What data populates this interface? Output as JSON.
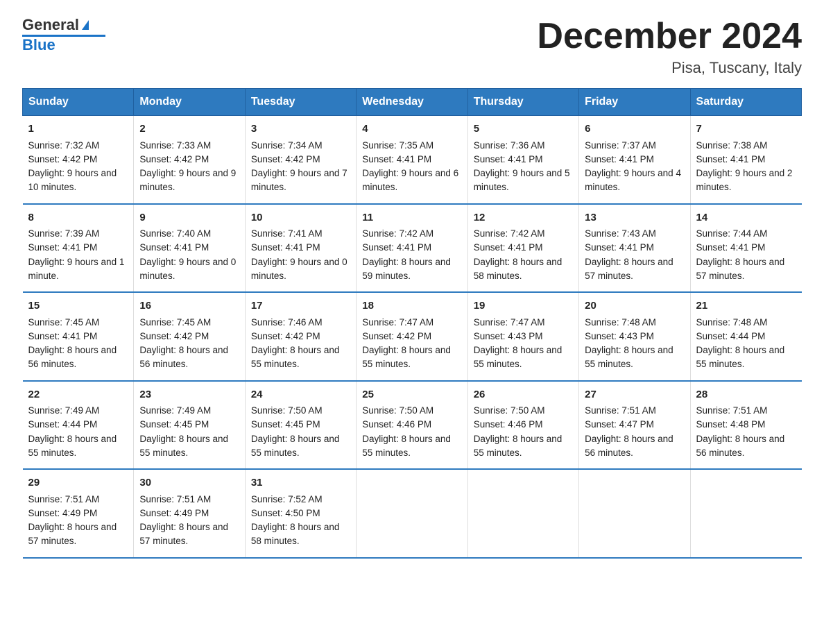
{
  "header": {
    "logo_general": "General",
    "logo_blue": "Blue",
    "title": "December 2024",
    "subtitle": "Pisa, Tuscany, Italy"
  },
  "days_of_week": [
    "Sunday",
    "Monday",
    "Tuesday",
    "Wednesday",
    "Thursday",
    "Friday",
    "Saturday"
  ],
  "weeks": [
    [
      {
        "day": "1",
        "sunrise": "7:32 AM",
        "sunset": "4:42 PM",
        "daylight": "9 hours and 10 minutes."
      },
      {
        "day": "2",
        "sunrise": "7:33 AM",
        "sunset": "4:42 PM",
        "daylight": "9 hours and 9 minutes."
      },
      {
        "day": "3",
        "sunrise": "7:34 AM",
        "sunset": "4:42 PM",
        "daylight": "9 hours and 7 minutes."
      },
      {
        "day": "4",
        "sunrise": "7:35 AM",
        "sunset": "4:41 PM",
        "daylight": "9 hours and 6 minutes."
      },
      {
        "day": "5",
        "sunrise": "7:36 AM",
        "sunset": "4:41 PM",
        "daylight": "9 hours and 5 minutes."
      },
      {
        "day": "6",
        "sunrise": "7:37 AM",
        "sunset": "4:41 PM",
        "daylight": "9 hours and 4 minutes."
      },
      {
        "day": "7",
        "sunrise": "7:38 AM",
        "sunset": "4:41 PM",
        "daylight": "9 hours and 2 minutes."
      }
    ],
    [
      {
        "day": "8",
        "sunrise": "7:39 AM",
        "sunset": "4:41 PM",
        "daylight": "9 hours and 1 minute."
      },
      {
        "day": "9",
        "sunrise": "7:40 AM",
        "sunset": "4:41 PM",
        "daylight": "9 hours and 0 minutes."
      },
      {
        "day": "10",
        "sunrise": "7:41 AM",
        "sunset": "4:41 PM",
        "daylight": "9 hours and 0 minutes."
      },
      {
        "day": "11",
        "sunrise": "7:42 AM",
        "sunset": "4:41 PM",
        "daylight": "8 hours and 59 minutes."
      },
      {
        "day": "12",
        "sunrise": "7:42 AM",
        "sunset": "4:41 PM",
        "daylight": "8 hours and 58 minutes."
      },
      {
        "day": "13",
        "sunrise": "7:43 AM",
        "sunset": "4:41 PM",
        "daylight": "8 hours and 57 minutes."
      },
      {
        "day": "14",
        "sunrise": "7:44 AM",
        "sunset": "4:41 PM",
        "daylight": "8 hours and 57 minutes."
      }
    ],
    [
      {
        "day": "15",
        "sunrise": "7:45 AM",
        "sunset": "4:41 PM",
        "daylight": "8 hours and 56 minutes."
      },
      {
        "day": "16",
        "sunrise": "7:45 AM",
        "sunset": "4:42 PM",
        "daylight": "8 hours and 56 minutes."
      },
      {
        "day": "17",
        "sunrise": "7:46 AM",
        "sunset": "4:42 PM",
        "daylight": "8 hours and 55 minutes."
      },
      {
        "day": "18",
        "sunrise": "7:47 AM",
        "sunset": "4:42 PM",
        "daylight": "8 hours and 55 minutes."
      },
      {
        "day": "19",
        "sunrise": "7:47 AM",
        "sunset": "4:43 PM",
        "daylight": "8 hours and 55 minutes."
      },
      {
        "day": "20",
        "sunrise": "7:48 AM",
        "sunset": "4:43 PM",
        "daylight": "8 hours and 55 minutes."
      },
      {
        "day": "21",
        "sunrise": "7:48 AM",
        "sunset": "4:44 PM",
        "daylight": "8 hours and 55 minutes."
      }
    ],
    [
      {
        "day": "22",
        "sunrise": "7:49 AM",
        "sunset": "4:44 PM",
        "daylight": "8 hours and 55 minutes."
      },
      {
        "day": "23",
        "sunrise": "7:49 AM",
        "sunset": "4:45 PM",
        "daylight": "8 hours and 55 minutes."
      },
      {
        "day": "24",
        "sunrise": "7:50 AM",
        "sunset": "4:45 PM",
        "daylight": "8 hours and 55 minutes."
      },
      {
        "day": "25",
        "sunrise": "7:50 AM",
        "sunset": "4:46 PM",
        "daylight": "8 hours and 55 minutes."
      },
      {
        "day": "26",
        "sunrise": "7:50 AM",
        "sunset": "4:46 PM",
        "daylight": "8 hours and 55 minutes."
      },
      {
        "day": "27",
        "sunrise": "7:51 AM",
        "sunset": "4:47 PM",
        "daylight": "8 hours and 56 minutes."
      },
      {
        "day": "28",
        "sunrise": "7:51 AM",
        "sunset": "4:48 PM",
        "daylight": "8 hours and 56 minutes."
      }
    ],
    [
      {
        "day": "29",
        "sunrise": "7:51 AM",
        "sunset": "4:49 PM",
        "daylight": "8 hours and 57 minutes."
      },
      {
        "day": "30",
        "sunrise": "7:51 AM",
        "sunset": "4:49 PM",
        "daylight": "8 hours and 57 minutes."
      },
      {
        "day": "31",
        "sunrise": "7:52 AM",
        "sunset": "4:50 PM",
        "daylight": "8 hours and 58 minutes."
      },
      null,
      null,
      null,
      null
    ]
  ],
  "labels": {
    "sunrise": "Sunrise:",
    "sunset": "Sunset:",
    "daylight": "Daylight:"
  }
}
